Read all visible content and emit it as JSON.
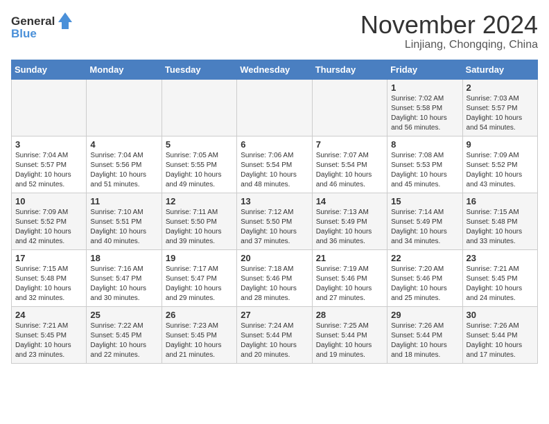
{
  "header": {
    "logo_general": "General",
    "logo_blue": "Blue",
    "month_title": "November 2024",
    "location": "Linjiang, Chongqing, China"
  },
  "weekdays": [
    "Sunday",
    "Monday",
    "Tuesday",
    "Wednesday",
    "Thursday",
    "Friday",
    "Saturday"
  ],
  "weeks": [
    [
      {
        "day": "",
        "sunrise": "",
        "sunset": "",
        "daylight": ""
      },
      {
        "day": "",
        "sunrise": "",
        "sunset": "",
        "daylight": ""
      },
      {
        "day": "",
        "sunrise": "",
        "sunset": "",
        "daylight": ""
      },
      {
        "day": "",
        "sunrise": "",
        "sunset": "",
        "daylight": ""
      },
      {
        "day": "",
        "sunrise": "",
        "sunset": "",
        "daylight": ""
      },
      {
        "day": "1",
        "sunrise": "Sunrise: 7:02 AM",
        "sunset": "Sunset: 5:58 PM",
        "daylight": "Daylight: 10 hours and 56 minutes."
      },
      {
        "day": "2",
        "sunrise": "Sunrise: 7:03 AM",
        "sunset": "Sunset: 5:57 PM",
        "daylight": "Daylight: 10 hours and 54 minutes."
      }
    ],
    [
      {
        "day": "3",
        "sunrise": "Sunrise: 7:04 AM",
        "sunset": "Sunset: 5:57 PM",
        "daylight": "Daylight: 10 hours and 52 minutes."
      },
      {
        "day": "4",
        "sunrise": "Sunrise: 7:04 AM",
        "sunset": "Sunset: 5:56 PM",
        "daylight": "Daylight: 10 hours and 51 minutes."
      },
      {
        "day": "5",
        "sunrise": "Sunrise: 7:05 AM",
        "sunset": "Sunset: 5:55 PM",
        "daylight": "Daylight: 10 hours and 49 minutes."
      },
      {
        "day": "6",
        "sunrise": "Sunrise: 7:06 AM",
        "sunset": "Sunset: 5:54 PM",
        "daylight": "Daylight: 10 hours and 48 minutes."
      },
      {
        "day": "7",
        "sunrise": "Sunrise: 7:07 AM",
        "sunset": "Sunset: 5:54 PM",
        "daylight": "Daylight: 10 hours and 46 minutes."
      },
      {
        "day": "8",
        "sunrise": "Sunrise: 7:08 AM",
        "sunset": "Sunset: 5:53 PM",
        "daylight": "Daylight: 10 hours and 45 minutes."
      },
      {
        "day": "9",
        "sunrise": "Sunrise: 7:09 AM",
        "sunset": "Sunset: 5:52 PM",
        "daylight": "Daylight: 10 hours and 43 minutes."
      }
    ],
    [
      {
        "day": "10",
        "sunrise": "Sunrise: 7:09 AM",
        "sunset": "Sunset: 5:52 PM",
        "daylight": "Daylight: 10 hours and 42 minutes."
      },
      {
        "day": "11",
        "sunrise": "Sunrise: 7:10 AM",
        "sunset": "Sunset: 5:51 PM",
        "daylight": "Daylight: 10 hours and 40 minutes."
      },
      {
        "day": "12",
        "sunrise": "Sunrise: 7:11 AM",
        "sunset": "Sunset: 5:50 PM",
        "daylight": "Daylight: 10 hours and 39 minutes."
      },
      {
        "day": "13",
        "sunrise": "Sunrise: 7:12 AM",
        "sunset": "Sunset: 5:50 PM",
        "daylight": "Daylight: 10 hours and 37 minutes."
      },
      {
        "day": "14",
        "sunrise": "Sunrise: 7:13 AM",
        "sunset": "Sunset: 5:49 PM",
        "daylight": "Daylight: 10 hours and 36 minutes."
      },
      {
        "day": "15",
        "sunrise": "Sunrise: 7:14 AM",
        "sunset": "Sunset: 5:49 PM",
        "daylight": "Daylight: 10 hours and 34 minutes."
      },
      {
        "day": "16",
        "sunrise": "Sunrise: 7:15 AM",
        "sunset": "Sunset: 5:48 PM",
        "daylight": "Daylight: 10 hours and 33 minutes."
      }
    ],
    [
      {
        "day": "17",
        "sunrise": "Sunrise: 7:15 AM",
        "sunset": "Sunset: 5:48 PM",
        "daylight": "Daylight: 10 hours and 32 minutes."
      },
      {
        "day": "18",
        "sunrise": "Sunrise: 7:16 AM",
        "sunset": "Sunset: 5:47 PM",
        "daylight": "Daylight: 10 hours and 30 minutes."
      },
      {
        "day": "19",
        "sunrise": "Sunrise: 7:17 AM",
        "sunset": "Sunset: 5:47 PM",
        "daylight": "Daylight: 10 hours and 29 minutes."
      },
      {
        "day": "20",
        "sunrise": "Sunrise: 7:18 AM",
        "sunset": "Sunset: 5:46 PM",
        "daylight": "Daylight: 10 hours and 28 minutes."
      },
      {
        "day": "21",
        "sunrise": "Sunrise: 7:19 AM",
        "sunset": "Sunset: 5:46 PM",
        "daylight": "Daylight: 10 hours and 27 minutes."
      },
      {
        "day": "22",
        "sunrise": "Sunrise: 7:20 AM",
        "sunset": "Sunset: 5:46 PM",
        "daylight": "Daylight: 10 hours and 25 minutes."
      },
      {
        "day": "23",
        "sunrise": "Sunrise: 7:21 AM",
        "sunset": "Sunset: 5:45 PM",
        "daylight": "Daylight: 10 hours and 24 minutes."
      }
    ],
    [
      {
        "day": "24",
        "sunrise": "Sunrise: 7:21 AM",
        "sunset": "Sunset: 5:45 PM",
        "daylight": "Daylight: 10 hours and 23 minutes."
      },
      {
        "day": "25",
        "sunrise": "Sunrise: 7:22 AM",
        "sunset": "Sunset: 5:45 PM",
        "daylight": "Daylight: 10 hours and 22 minutes."
      },
      {
        "day": "26",
        "sunrise": "Sunrise: 7:23 AM",
        "sunset": "Sunset: 5:45 PM",
        "daylight": "Daylight: 10 hours and 21 minutes."
      },
      {
        "day": "27",
        "sunrise": "Sunrise: 7:24 AM",
        "sunset": "Sunset: 5:44 PM",
        "daylight": "Daylight: 10 hours and 20 minutes."
      },
      {
        "day": "28",
        "sunrise": "Sunrise: 7:25 AM",
        "sunset": "Sunset: 5:44 PM",
        "daylight": "Daylight: 10 hours and 19 minutes."
      },
      {
        "day": "29",
        "sunrise": "Sunrise: 7:26 AM",
        "sunset": "Sunset: 5:44 PM",
        "daylight": "Daylight: 10 hours and 18 minutes."
      },
      {
        "day": "30",
        "sunrise": "Sunrise: 7:26 AM",
        "sunset": "Sunset: 5:44 PM",
        "daylight": "Daylight: 10 hours and 17 minutes."
      }
    ]
  ]
}
